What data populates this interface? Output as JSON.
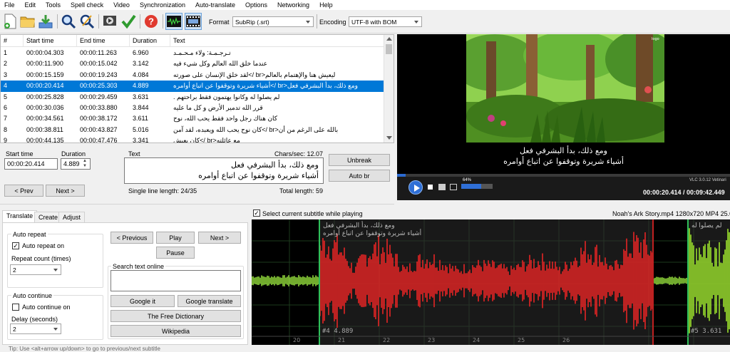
{
  "menu": [
    "File",
    "Edit",
    "Tools",
    "Spell check",
    "Video",
    "Synchronization",
    "Auto-translate",
    "Options",
    "Networking",
    "Help"
  ],
  "toolbar": {
    "format_label": "Format",
    "format_value": "SubRip (.srt)",
    "encoding_label": "Encoding",
    "encoding_value": "UTF-8 with BOM"
  },
  "grid": {
    "columns": [
      "#",
      "Start time",
      "End time",
      "Duration",
      "Text"
    ],
    "rows": [
      {
        "n": "1",
        "start": "00:00:04.303",
        "end": "00:00:11.263",
        "dur": "6.960",
        "text": "تـرجـمـة: ولاء مـحـمـد"
      },
      {
        "n": "2",
        "start": "00:00:11.900",
        "end": "00:00:15.042",
        "dur": "3.142",
        "text": "عندما خلق الله العالم وكل شيء فيه"
      },
      {
        "n": "3",
        "start": "00:00:15.159",
        "end": "00:00:19.243",
        "dur": "4.084",
        "text": "ليعيش هنا والإهتمام بالعالم<br />لقد خلق الإنسان على صورته"
      },
      {
        "n": "4",
        "start": "00:00:20.414",
        "end": "00:00:25.303",
        "dur": "4.889",
        "text": "ومع ذلك، بدأ البشرفي فعل<br />أشياء شريرة وتوقفوا عن اتباع أوامره"
      },
      {
        "n": "5",
        "start": "00:00:25.828",
        "end": "00:00:29.459",
        "dur": "3.631",
        "text": "لم يصلوا له وكانوا يهتمون فقط براحتهم ."
      },
      {
        "n": "6",
        "start": "00:00:30.036",
        "end": "00:00:33.880",
        "dur": "3.844",
        "text": "قرر الله تدمير الأرض و كل ما عليه"
      },
      {
        "n": "7",
        "start": "00:00:34.561",
        "end": "00:00:38.172",
        "dur": "3.611",
        "text": "كان هناك رجل واحد فقط يحب الله، نوح"
      },
      {
        "n": "8",
        "start": "00:00:38.811",
        "end": "00:00:43.827",
        "dur": "5.016",
        "text": "بالله على الرغم من أن<br />كان نوح يحب الله ويعبده، لقد آمن"
      },
      {
        "n": "9",
        "start": "00:00:44.135",
        "end": "00:00:47.476",
        "dur": "3.341",
        "text": "مع عائلته<br />كان يعيش"
      }
    ]
  },
  "video": {
    "sub_line1": "ومع ذلك، بدأ البشرفي فعل",
    "sub_line2": "أشياء شريرة وتوقفوا عن اتباع أوامره",
    "progress_label": "64%",
    "progress": 0.64,
    "vlc_label": "VLC 3.0.12 Vetinari",
    "time_text": "00:00:20.414 / 00:09:42.449"
  },
  "edit": {
    "start_label": "Start time",
    "start_value": "00:00:20.414",
    "duration_label": "Duration",
    "duration_value": "4.889",
    "text_label": "Text",
    "chars_sec": "Chars/sec: 12.07",
    "line1": "ومع ذلك، بدأ البشرفي فعل",
    "line2": "أشياء شريرة وتوقفوا عن اتباع أوامره",
    "single_line_length": "Single line length: 24/35",
    "total_length": "Total length: 59",
    "unbreak": "Unbreak",
    "auto_br": "Auto br",
    "prev": "< Prev",
    "next": "Next >"
  },
  "tabs": [
    "Translate",
    "Create",
    "Adjust"
  ],
  "translate": {
    "auto_repeat_title": "Auto repeat",
    "auto_repeat_on": "Auto repeat on",
    "repeat_count_label": "Repeat count (times)",
    "repeat_count_value": "2",
    "auto_continue_title": "Auto continue",
    "auto_continue_on": "Auto continue on",
    "delay_label": "Delay (seconds)",
    "delay_value": "2",
    "previous": "< Previous",
    "play": "Play",
    "next": "Next >",
    "pause": "Pause",
    "search_label": "Search text online",
    "google_it": "Google it",
    "google_translate": "Google translate",
    "free_dictionary": "The Free Dictionary",
    "wikipedia": "Wikipedia",
    "tip": "Tip: Use <alt+arrow up/down> to go to previous/next subtitle"
  },
  "waveform": {
    "select_current": "Select current subtitle while playing",
    "file_info": "Noah's Ark  Story.mp4 1280x720 MP4 25.0",
    "sub4_line1": "ومع ذلك، بدأ البشرفي فعل",
    "sub4_line2": "أشياء شريرة وتوقفوا عن اتباع أوامره",
    "sub5_line1": "لم يصلوا له",
    "sub4_label": "#4  4.889",
    "sub5_label": "#5  3.631",
    "ticks": [
      "20",
      "21",
      "22",
      "23",
      "24",
      "25",
      "26"
    ]
  }
}
